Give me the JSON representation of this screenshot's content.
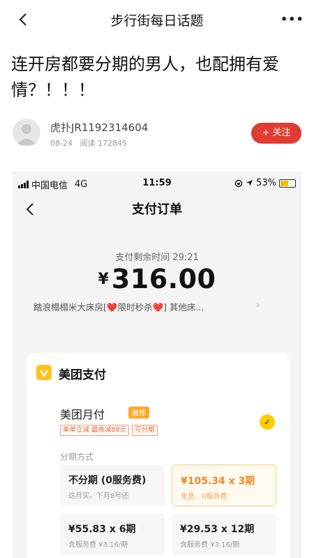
{
  "topbar": {
    "title": "步行街每日话题",
    "more_label": "•••"
  },
  "post": {
    "title": "连开房都要分期的男人，也配拥有爱情？！！！",
    "author": "虎扑JR1192314604",
    "date": "08-24",
    "reads": "阅读 172845",
    "follow_label": "+ 关注"
  },
  "screenshot": {
    "status_bar": {
      "carrier": "中国电信",
      "network": "4G",
      "time": "11:59",
      "battery": "53%",
      "battery_level": 0.53
    },
    "nav_title": "支付订单",
    "timer": "支付剩余时间 29:21",
    "currency": "¥",
    "amount": "316.00",
    "product": {
      "name_prefix": "踏浪榻榻米大床房[",
      "heart1": "❤️",
      "promo_text": "限时秒杀",
      "heart2": "❤️",
      "name_suffix": "] 其他床...",
      "chevron": "›"
    },
    "payment": {
      "title": "美团支付",
      "monthly_label": "美团月付",
      "recommend_tag": "推荐",
      "promo_tags": [
        "单单立减 最高减88元",
        "可分期"
      ],
      "check_mark": "✓",
      "installment_label": "分期方式",
      "options": [
        {
          "main": "不分期 (0服务费)",
          "sub": "这月买，下月8号还",
          "selected": false
        },
        {
          "main": "¥105.34 x 3期",
          "sub": "免息、0服务费",
          "selected": true
        },
        {
          "main": "¥55.83 x 6期",
          "sub": "含服务费 ¥3.16/期",
          "selected": false
        },
        {
          "main": "¥29.53 x 12期",
          "sub": "含服务费 ¥3.16/期",
          "selected": false
        }
      ]
    }
  },
  "colors": {
    "follow_red": "#e03c31",
    "meituan_yellow": "#ffc21a",
    "highlight_orange": "#f08a24"
  }
}
